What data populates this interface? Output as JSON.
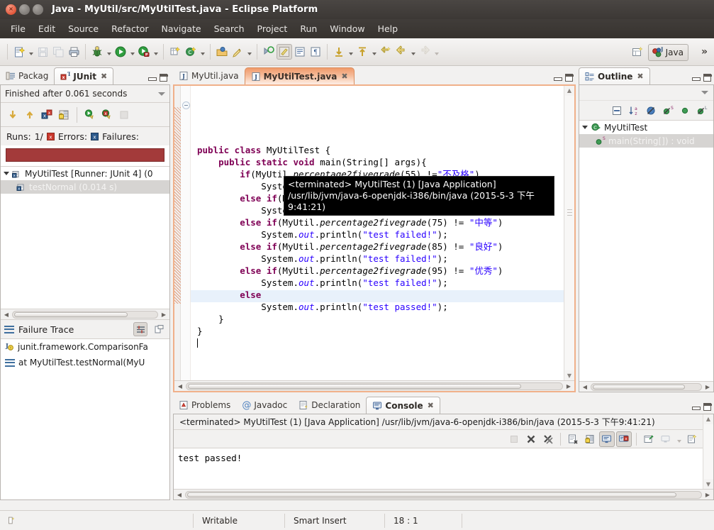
{
  "window": {
    "title": "Java - MyUtil/src/MyUtilTest.java - Eclipse Platform",
    "close_label": "×",
    "minimize_label": "–",
    "maximize_label": "□"
  },
  "menu": {
    "items": [
      "File",
      "Edit",
      "Source",
      "Refactor",
      "Navigate",
      "Search",
      "Project",
      "Run",
      "Window",
      "Help"
    ]
  },
  "toolbar": {
    "perspective_label": "Java",
    "overflow_label": "»",
    "icons": [
      "new-wizard-icon",
      "save-icon",
      "save-all-icon",
      "print-icon",
      "debug-icon",
      "run-icon",
      "run-coverage-icon",
      "new-java-package-icon",
      "new-java-class-icon",
      "open-type-icon",
      "search-icon",
      "next-annotation-icon",
      "previous-annotation-icon",
      "last-edit-location-icon",
      "back-icon",
      "forward-icon",
      "open-perspective-icon",
      "java-perspective-icon"
    ]
  },
  "junit_view": {
    "tabs": [
      {
        "label": "Packag",
        "icon": "package-explorer-icon",
        "active": false,
        "closable": false
      },
      {
        "label": "JUnit",
        "icon": "junit-icon",
        "active": true,
        "closable": true
      }
    ],
    "close_label": "✖",
    "status_text": "Finished after 0.061 seconds",
    "toolbar_icons": [
      "next-failure-icon",
      "previous-failure-icon",
      "show-failures-only-icon",
      "lock-scroll-icon",
      "rerun-test-icon",
      "rerun-failed-tests-icon",
      "stop-icon"
    ],
    "counts": {
      "runs_label": "Runs:",
      "runs_value": "1/",
      "errors_label": "Errors:",
      "failures_label": "Failures:"
    },
    "progress_color": "#a33a3a",
    "tree": [
      {
        "label": "MyUtilTest [Runner: JUnit 4] (0",
        "icon": "test-suite-icon",
        "expanded": true,
        "selected": false,
        "indent": 0
      },
      {
        "label": "testNormal (0.014 s)",
        "icon": "test-case-icon",
        "expanded": false,
        "selected": true,
        "indent": 1
      }
    ],
    "failure_trace": {
      "title": "Failure Trace",
      "buttons": [
        "filter-stack-trace-icon",
        "copy-trace-icon"
      ],
      "rows": [
        {
          "icon": "exception-icon",
          "label": "junit.framework.ComparisonFa"
        },
        {
          "icon": "stack-frame-icon",
          "label": "at MyUtilTest.testNormal(MyU"
        }
      ]
    }
  },
  "editor": {
    "tabs": [
      {
        "label": "MyUtil.java",
        "icon": "java-file-icon",
        "active": false,
        "closable": false
      },
      {
        "label": "MyUtilTest.java",
        "icon": "java-file-icon",
        "active": true,
        "closable": true
      }
    ],
    "close_label": "✖",
    "code_lines": [
      "public class MyUtilTest {",
      "    public static void main(String[] args){",
      "        if(MyUtil.percentage2fivegrade(55) !=\"不及格\")",
      "            System.out.println(\"test failed!\");",
      "        else if(MyUtil.percentage2fivegrade(65) != \"及格\")",
      "            System.out.println(\"test failed!\");",
      "        else if(MyUtil.percentage2fivegrade(75) != \"中等\")",
      "            System.out.println(\"test failed!\");",
      "        else if(MyUtil.percentage2fivegrade(85) != \"良好\")",
      "            System.out.println(\"test failed!\");",
      "        else if(MyUtil.percentage2fivegrade(95) != \"优秀\")",
      "            System.out.println(\"test failed!\");",
      "        else",
      "            System.out.println(\"test passed!\");",
      "    }",
      "}",
      ""
    ]
  },
  "tooltip": {
    "text": "<terminated> MyUtilTest (1) [Java Application] /usr/lib/jvm/java-6-openjdk-i386/bin/java (2015-5-3 下午9:41:21)"
  },
  "outline_view": {
    "tabs": [
      {
        "label": "Outline",
        "icon": "outline-icon",
        "active": true,
        "closable": true
      }
    ],
    "close_label": "✖",
    "toolbar_icons": [
      "collapse-all-icon",
      "sort-alphabetically-icon",
      "hide-fields-icon",
      "hide-static-members-icon",
      "hide-non-public-members-icon",
      "hide-local-types-icon"
    ],
    "tree": [
      {
        "label": "MyUtilTest",
        "icon": "class-icon",
        "expanded": true,
        "selected": false,
        "indent": 0
      },
      {
        "label": "main(String[]) : void",
        "icon": "public-static-method-icon",
        "expanded": false,
        "selected": true,
        "indent": 1
      }
    ]
  },
  "console_view": {
    "tabs": [
      {
        "label": "Problems",
        "icon": "problems-icon",
        "active": false,
        "closable": false
      },
      {
        "label": "Javadoc",
        "icon": "javadoc-icon",
        "active": false,
        "closable": false
      },
      {
        "label": "Declaration",
        "icon": "declaration-icon",
        "active": false,
        "closable": false
      },
      {
        "label": "Console",
        "icon": "console-icon",
        "active": true,
        "closable": true
      }
    ],
    "close_label": "✖",
    "header": "<terminated> MyUtilTest (1) [Java Application] /usr/lib/jvm/java-6-openjdk-i386/bin/java (2015-5-3 下午9:41:21)",
    "toolbar_icons": [
      "terminate-icon",
      "remove-launch-icon",
      "remove-all-terminated-icon",
      "clear-console-icon",
      "scroll-lock-icon",
      "show-console-on-output-icon",
      "show-console-on-error-icon",
      "pin-console-icon",
      "display-selected-console-icon",
      "open-console-icon"
    ],
    "output": "test passed!"
  },
  "statusbar": {
    "writable": "Writable",
    "insert_mode": "Smart Insert",
    "position": "18 : 1"
  }
}
